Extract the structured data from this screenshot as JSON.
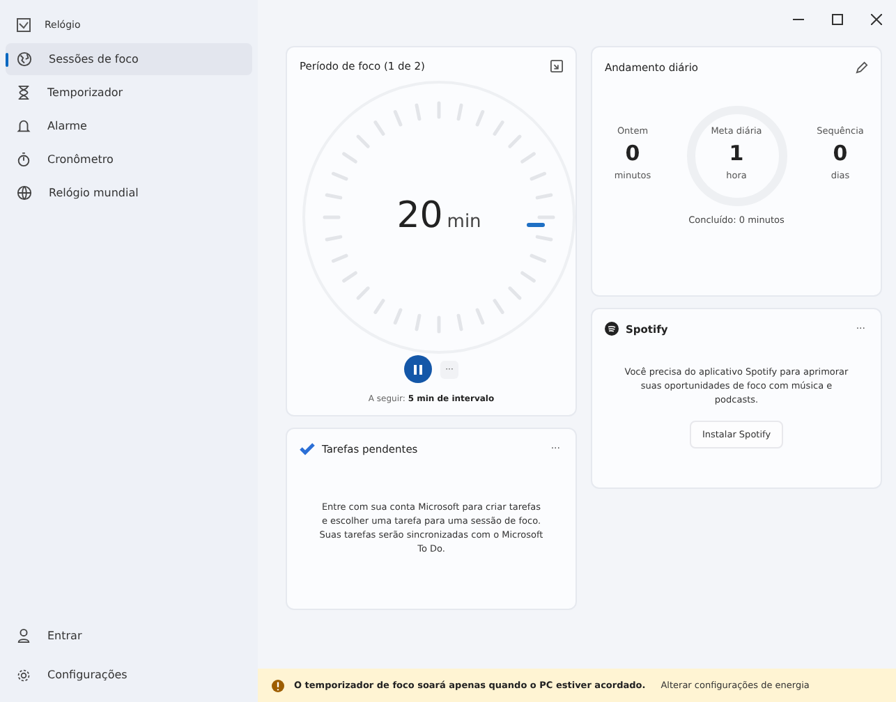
{
  "app_title": "Relógio",
  "sidebar": {
    "items": [
      {
        "label": "Sessões de foco",
        "selected": true
      },
      {
        "label": "Temporizador",
        "selected": false
      },
      {
        "label": "Alarme",
        "selected": false
      },
      {
        "label": "Cronômetro",
        "selected": false
      },
      {
        "label": "Relógio mundial",
        "selected": false
      }
    ],
    "footer": [
      {
        "label": "Entrar"
      },
      {
        "label": "Configurações"
      }
    ]
  },
  "focus": {
    "title": "Período de foco (1 de 2)",
    "value": "20",
    "unit": "min",
    "next": "A seguir: **5 min de intervalo**",
    "more": "···"
  },
  "progress": {
    "title": "Andamento diário",
    "stats": [
      {
        "label": "Ontem",
        "value": "0",
        "unit": "minutos"
      },
      {
        "label": "Meta diária",
        "value": "1",
        "unit": "hora"
      },
      {
        "label": "Sequência",
        "value": "0",
        "unit": "dias"
      }
    ],
    "completed": "Concluído: 0 minutos"
  },
  "tasks": {
    "title": "Tarefas pendentes",
    "more": "···",
    "message": "Entre com sua conta Microsoft para criar tarefas e escolher uma tarefa para uma sessão de foco. Suas tarefas serão sincronizadas com o Microsoft To Do."
  },
  "spotify": {
    "title": "Spotify",
    "more": "···",
    "message": "Você precisa do aplicativo Spotify para aprimorar suas oportunidades de foco com música e podcasts.",
    "button": "Instalar Spotify"
  },
  "notice": {
    "message": "O temporizador de foco soará apenas quando o PC estiver acordado.",
    "link": "Alterar configurações de energia"
  }
}
